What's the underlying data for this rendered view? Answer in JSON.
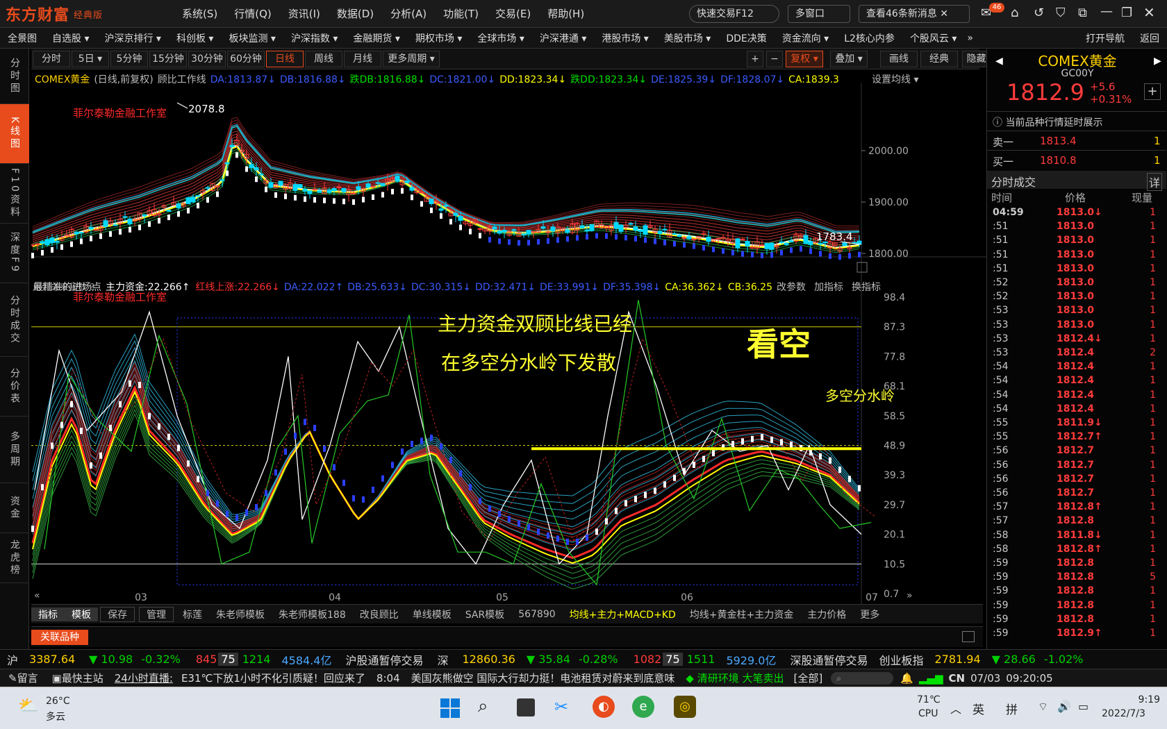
{
  "app": {
    "logo": "东方财富",
    "edition": "经典版"
  },
  "menu": [
    "系统(S)",
    "行情(Q)",
    "资讯(I)",
    "数据(D)",
    "分析(A)",
    "功能(T)",
    "交易(E)",
    "帮助(H)"
  ],
  "title_right": {
    "quick_trade": "快速交易F12",
    "multi_window": "多窗口",
    "news": "查看46条新消息",
    "badge": "46"
  },
  "nav": [
    "全景图",
    "自选股 ▾",
    "沪深京排行 ▾",
    "科创板 ▾",
    "板块监测 ▾",
    "沪深指数 ▾",
    "金融期货 ▾",
    "期权市场 ▾",
    "全球市场 ▾",
    "沪深港通 ▾",
    "港股市场 ▾",
    "美股市场 ▾",
    "DDE决策",
    "资金流向 ▾",
    "L2核心内参",
    "个股风云 ▾"
  ],
  "nav_right": [
    "打开导航",
    "返回"
  ],
  "left_tabs": [
    "分时图",
    "K线图",
    "F10资料",
    "深度F9",
    "分时成交",
    "分价表",
    "多周期",
    "资金",
    "龙虎榜"
  ],
  "periods": [
    "分时",
    "5日 ▾",
    "5分钟",
    "15分钟",
    "30分钟",
    "60分钟",
    "日线",
    "周线",
    "月线",
    "更多周期 ▾"
  ],
  "period_tools": [
    "+",
    "−",
    "复权 ▾",
    "叠加 ▾",
    "画线",
    "经典",
    "隐藏 »"
  ],
  "main_chart": {
    "symbol": "COMEX黄金",
    "mode": "(日线,前复权)",
    "indicator": "顾比工作线",
    "items": [
      {
        "t": "DA:1813.87↓",
        "c": "#3b5cff"
      },
      {
        "t": "DB:1816.88↓",
        "c": "#3b5cff"
      },
      {
        "t": "跌DB:1816.88↓",
        "c": "#00e000"
      },
      {
        "t": "DC:1821.00↓",
        "c": "#3b5cff"
      },
      {
        "t": "DD:1823.34↓",
        "c": "#ffff00"
      },
      {
        "t": "跌DD:1823.34↓",
        "c": "#00e000"
      },
      {
        "t": "DE:1825.39↓",
        "c": "#3b5cff"
      },
      {
        "t": "DF:1828.07↓",
        "c": "#3b5cff"
      },
      {
        "t": "CA:1839.3",
        "c": "#ffff00"
      }
    ],
    "settings": "设置均线 ▾",
    "watermark": "菲尔泰勒金融工作室",
    "high_label": "2078.8",
    "low_label": "1783.4",
    "y_ticks": [
      "2000.00",
      "1900.00",
      "1800.00"
    ]
  },
  "sub_chart": {
    "title": "最精准的进场点",
    "main_fund": "主力资金:22.266↑",
    "items": [
      {
        "t": "红线上涨:22.266↓",
        "c": "#ff3030"
      },
      {
        "t": "DA:22.022↑",
        "c": "#3b5cff"
      },
      {
        "t": "DB:25.633↓",
        "c": "#3b5cff"
      },
      {
        "t": "DC:30.315↓",
        "c": "#3b5cff"
      },
      {
        "t": "DD:32.471↓",
        "c": "#3b5cff"
      },
      {
        "t": "DE:33.991↓",
        "c": "#3b5cff"
      },
      {
        "t": "DF:35.398↓",
        "c": "#3b5cff"
      },
      {
        "t": "CA:36.362↓",
        "c": "#ffff00"
      },
      {
        "t": "CB:36.25",
        "c": "#ffff00"
      }
    ],
    "buttons": [
      "改参数",
      "加指标",
      "换指标"
    ],
    "hint": "用到未来函数 ?",
    "watermark": "菲尔泰勒金融工作室",
    "y_ticks": [
      "98.4",
      "87.3",
      "77.8",
      "68.1",
      "58.5",
      "48.9",
      "39.3",
      "29.7",
      "20.1",
      "10.5",
      "0.7"
    ],
    "annot1": "主力资金双顾比线已经",
    "annot2": "在多空分水岭下发散",
    "annot3": "看空",
    "annot4": "多空分水岭"
  },
  "x_ticks": [
    "03",
    "04",
    "05",
    "06",
    "07"
  ],
  "bottom_tabs": [
    "指标",
    "模板",
    "保存",
    "管理",
    "标莲",
    "朱老师模板",
    "朱老师模板188",
    "改良顾比",
    "单线模板",
    "SAR模板",
    "567890",
    "均线+主力+MACD+KD",
    "均线+黄金柱+主力资金",
    "主力价格",
    "更多"
  ],
  "related": "关联品种",
  "quote": {
    "name": "COMEX黄金",
    "code": "GC00Y",
    "price": "1812.9",
    "change": "+5.6",
    "pct": "+0.31%",
    "delay_note": "当前品种行情延时展示",
    "sell_label": "卖一",
    "sell_price": "1813.4",
    "sell_vol": "1",
    "buy_label": "买一",
    "buy_price": "1810.8",
    "buy_vol": "1",
    "trades_title": "分时成交",
    "detail": "详",
    "cols": [
      "时间",
      "价格",
      "现量"
    ]
  },
  "trades": [
    [
      "04:59",
      "1813.0↓",
      "1"
    ],
    [
      ":51",
      "1813.0",
      "1"
    ],
    [
      ":51",
      "1813.0",
      "1"
    ],
    [
      ":51",
      "1813.0",
      "1"
    ],
    [
      ":51",
      "1813.0",
      "1"
    ],
    [
      ":52",
      "1813.0",
      "1"
    ],
    [
      ":52",
      "1813.0",
      "1"
    ],
    [
      ":53",
      "1813.0",
      "1"
    ],
    [
      ":53",
      "1813.0",
      "1"
    ],
    [
      ":53",
      "1812.4↓",
      "1"
    ],
    [
      ":53",
      "1812.4",
      "2"
    ],
    [
      ":54",
      "1812.4",
      "1"
    ],
    [
      ":54",
      "1812.4",
      "1"
    ],
    [
      ":54",
      "1812.4",
      "1"
    ],
    [
      ":54",
      "1812.4",
      "1"
    ],
    [
      ":55",
      "1811.9↓",
      "1"
    ],
    [
      ":55",
      "1812.7↑",
      "1"
    ],
    [
      ":56",
      "1812.7",
      "1"
    ],
    [
      ":56",
      "1812.7",
      "1"
    ],
    [
      ":56",
      "1812.7",
      "1"
    ],
    [
      ":56",
      "1812.7",
      "1"
    ],
    [
      ":57",
      "1812.8↑",
      "1"
    ],
    [
      ":57",
      "1812.8",
      "1"
    ],
    [
      ":58",
      "1811.8↓",
      "1"
    ],
    [
      ":58",
      "1812.8↑",
      "1"
    ],
    [
      ":59",
      "1812.8",
      "1"
    ],
    [
      ":59",
      "1812.8",
      "5"
    ],
    [
      ":59",
      "1812.8",
      "1"
    ],
    [
      ":59",
      "1812.8",
      "1"
    ],
    [
      ":59",
      "1812.8",
      "1"
    ],
    [
      ":59",
      "1812.9↑",
      "1"
    ]
  ],
  "ticker": {
    "sh_label": "沪",
    "sh_val": "3387.64",
    "sh_chg": "▼ 10.98",
    "sh_pct": "-0.32%",
    "sh_up": "845",
    "sh_flat": "75",
    "sh_down": "1214",
    "sh_amt": "4584.4亿",
    "sh_note": "沪股通暂停交易",
    "sz_label": "深",
    "sz_val": "12860.36",
    "sz_chg": "▼ 35.84",
    "sz_pct": "-0.28%",
    "sz_up": "1082",
    "sz_flat": "75",
    "sz_down": "1511",
    "sz_amt": "5929.0亿",
    "sz_note": "深股通暂停交易",
    "cy_label": "创业板指",
    "cy_val": "2781.94",
    "cy_chg": "▼ 28.66",
    "cy_pct": "-1.02%"
  },
  "news": {
    "msg": "留言",
    "site": "最快主站",
    "live": "24小时直播:",
    "live_text": "E31℃下放1小时不化引质疑！回应来了",
    "time": "8:04",
    "headline": "美国灰熊做空 国际大行却力挺！电池租赁对蔚来到底意味",
    "env": "清研环境 大笔卖出",
    "all": "[全部]",
    "cn": "CN",
    "date": "07/03",
    "clock": "09:20:05"
  },
  "taskbar": {
    "weather_temp": "26°C",
    "weather_desc": "多云",
    "cpu_temp": "71℃",
    "cpu": "CPU",
    "lang1": "英",
    "lang2": "拼",
    "time": "9:19",
    "date": "2022/7/3"
  }
}
